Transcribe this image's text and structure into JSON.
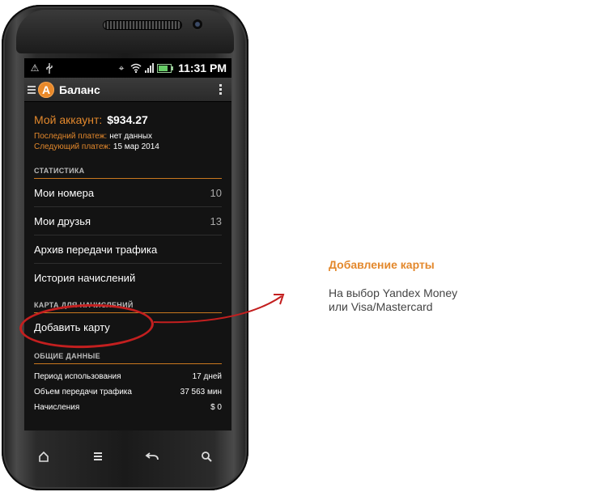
{
  "status_bar": {
    "time": "11:31 PM"
  },
  "action_bar": {
    "logo_letter": "A",
    "title": "Баланс"
  },
  "account": {
    "label": "Мой аккаунт:",
    "amount": "$934.27",
    "last_payment_label": "Последний платеж:",
    "last_payment_value": "нет данных",
    "next_payment_label": "Следующий платеж:",
    "next_payment_value": "15 мар 2014"
  },
  "stats": {
    "header": "СТАТИСТИКА",
    "items": [
      {
        "label": "Мои номера",
        "count": "10"
      },
      {
        "label": "Мои друзья",
        "count": "13"
      },
      {
        "label": "Архив передачи трафика",
        "count": ""
      },
      {
        "label": "История начислений",
        "count": ""
      }
    ]
  },
  "card": {
    "header": "КАРТА ДЛЯ НАЧИСЛЕНИЙ",
    "add_card": "Добавить карту"
  },
  "general": {
    "header": "ОБЩИЕ ДАННЫЕ",
    "rows": [
      {
        "label": "Период использования",
        "value": "17 дней"
      },
      {
        "label": "Объем передачи трафика",
        "value": "37 563 мин"
      },
      {
        "label": "Начисления",
        "value": "$ 0"
      }
    ]
  },
  "callout": {
    "title": "Добавление карты",
    "line1": "На выбор Yandex Money",
    "line2": "или Visa/Mastercard"
  },
  "colors": {
    "accent": "#e3882c",
    "highlight": "#c31f1f",
    "background": "#131313"
  }
}
